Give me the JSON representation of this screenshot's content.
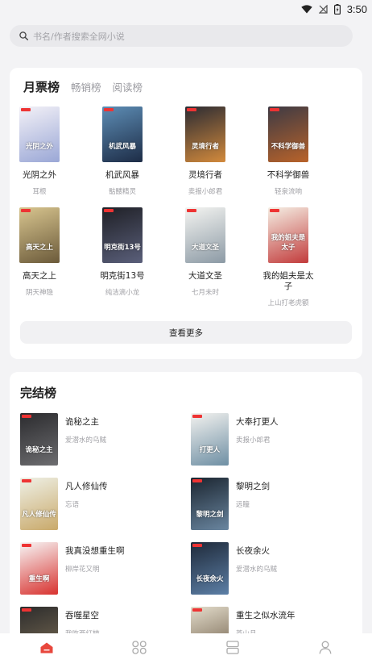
{
  "status_bar": {
    "time": "3:50",
    "wifi_icon": "wifi-icon",
    "signal_icon": "signal-off-icon",
    "battery_icon": "battery-icon"
  },
  "search": {
    "placeholder": "书名/作者搜索全网小说",
    "icon": "search-icon"
  },
  "ranking_tabs": [
    {
      "label": "月票榜",
      "active": true
    },
    {
      "label": "畅销榜",
      "active": false
    },
    {
      "label": "阅读榜",
      "active": false
    }
  ],
  "monthly_books": [
    {
      "title": "光阴之外",
      "author": "耳根",
      "cover_text": "光阴之外",
      "colors": [
        "#f3f1f7",
        "#9aa7d6"
      ]
    },
    {
      "title": "机武风暴",
      "author": "骷髅精灵",
      "cover_text": "机武风暴",
      "colors": [
        "#5d8db5",
        "#1d2c46"
      ]
    },
    {
      "title": "灵境行者",
      "author": "卖报小郎君",
      "cover_text": "灵境行者",
      "colors": [
        "#2b2b33",
        "#d38a3c"
      ]
    },
    {
      "title": "不科学御兽",
      "author": "轻泉流响",
      "cover_text": "不科学御兽",
      "colors": [
        "#3d3a44",
        "#b9632a"
      ]
    },
    {
      "title": "高天之上",
      "author": "阴天神隐",
      "cover_text": "高天之上",
      "colors": [
        "#d8c58f",
        "#6b5a3a"
      ]
    },
    {
      "title": "明克街13号",
      "author": "纯洁滴小龙",
      "cover_text": "明克街13号",
      "colors": [
        "#1f2026",
        "#5a5f7a"
      ]
    },
    {
      "title": "大道文圣",
      "author": "七月未时",
      "cover_text": "大道文圣",
      "colors": [
        "#f4f4f1",
        "#8c9aa5"
      ]
    },
    {
      "title": "我的姐夫是太子",
      "author": "上山打老虎额",
      "cover_text": "我的姐夫是太子",
      "colors": [
        "#f5efe4",
        "#c23b3b"
      ]
    }
  ],
  "more_button": "查看更多",
  "completed": {
    "title": "完结榜",
    "books": [
      {
        "title": "诡秘之主",
        "author": "爱潜水的乌贼",
        "cover_text": "诡秘之主",
        "colors": [
          "#2b2b2e",
          "#6d6d70"
        ]
      },
      {
        "title": "大奉打更人",
        "author": "卖报小郎君",
        "cover_text": "打更人",
        "colors": [
          "#f3f2ef",
          "#6e8fa4"
        ]
      },
      {
        "title": "凡人修仙传",
        "author": "忘语",
        "cover_text": "凡人修仙传",
        "colors": [
          "#eef0e6",
          "#c9a96a"
        ]
      },
      {
        "title": "黎明之剑",
        "author": "远瞳",
        "cover_text": "黎明之剑",
        "colors": [
          "#1b2530",
          "#6a86a0"
        ]
      },
      {
        "title": "我真没想重生啊",
        "author": "柳岸花又明",
        "cover_text": "重生啊",
        "colors": [
          "#f7f7f7",
          "#d8322f"
        ]
      },
      {
        "title": "长夜余火",
        "author": "爱潜水的乌贼",
        "cover_text": "长夜余火",
        "colors": [
          "#1f2a3a",
          "#5c7fa6"
        ]
      },
      {
        "title": "吞噬星空",
        "author": "我吃西红柿",
        "cover_text": "吞噬星空",
        "colors": [
          "#2c2c2c",
          "#7c6d55"
        ]
      },
      {
        "title": "重生之似水流年",
        "author": "苍山月",
        "cover_text": "似水流年",
        "colors": [
          "#e3dccb",
          "#6b5a45"
        ]
      }
    ]
  },
  "bottom_nav": [
    {
      "name": "home",
      "icon": "home-icon",
      "active": true,
      "accent": "#e8473d"
    },
    {
      "name": "category",
      "icon": "grid-icon",
      "active": false
    },
    {
      "name": "bookshelf",
      "icon": "bookshelf-icon",
      "active": false
    },
    {
      "name": "profile",
      "icon": "user-icon",
      "active": false
    }
  ]
}
